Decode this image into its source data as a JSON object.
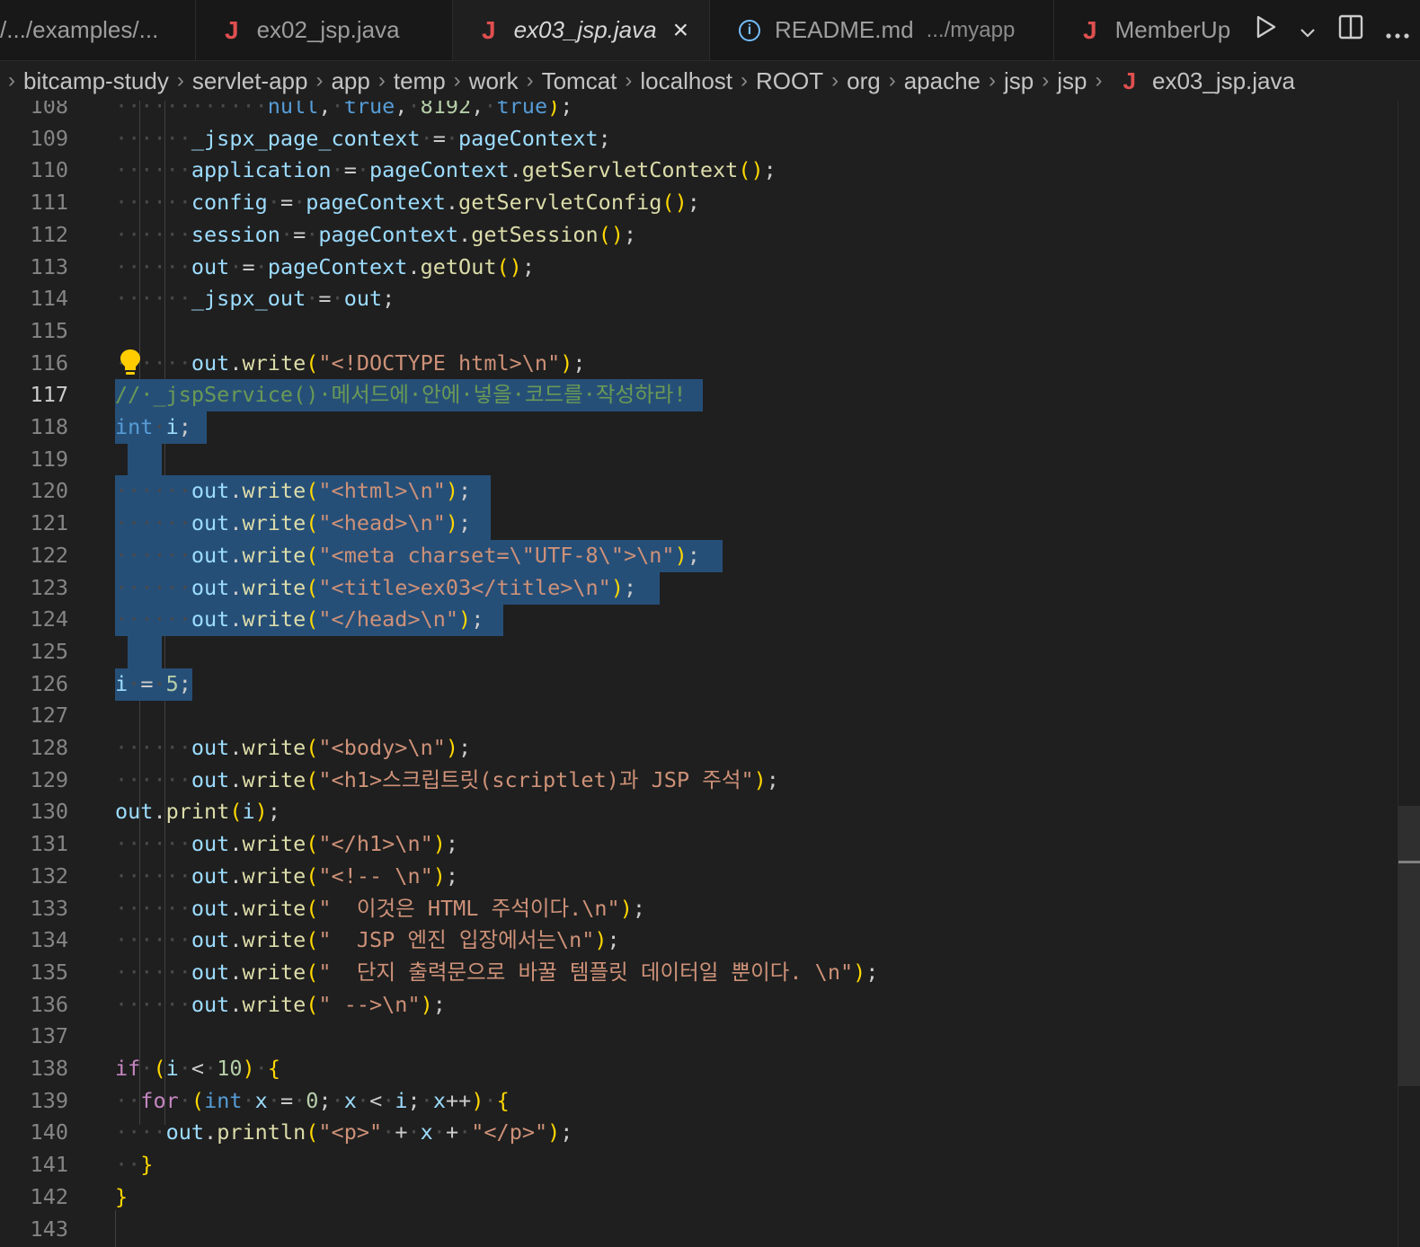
{
  "tabs": [
    {
      "label": "/.../examples/...",
      "desc": "",
      "icon": "none",
      "active": false
    },
    {
      "label": "ex02_jsp.java",
      "desc": "",
      "icon": "java-icon",
      "active": false
    },
    {
      "label": "ex03_jsp.java",
      "desc": "",
      "icon": "java-icon",
      "active": true
    },
    {
      "label": "README.md",
      "desc": ".../myapp",
      "icon": "info-icon",
      "active": false
    },
    {
      "label": "MemberUp",
      "desc": "",
      "icon": "java-icon",
      "active": false
    }
  ],
  "tab_actions": {
    "run_icon": "play-icon",
    "run_menu_icon": "chevron-down-icon",
    "split_icon": "split-editor-icon",
    "more_icon": "more-actions-icon"
  },
  "breadcrumb": [
    "bitcamp-study",
    "servlet-app",
    "app",
    "temp",
    "work",
    "Tomcat",
    "localhost",
    "ROOT",
    "org",
    "apache",
    "jsp",
    "jsp"
  ],
  "breadcrumb_file": "ex03_jsp.java",
  "current_line": 117,
  "colors": {
    "background": "#1f1f1f",
    "selection": "#264f78",
    "java_icon": "#e04f4f",
    "keyword": "#569cd6",
    "string": "#ce9178"
  },
  "lines": [
    {
      "n": "108",
      "text": "null, true, 8192, true);"
    },
    {
      "n": "109",
      "text": "_jspx_page_context = pageContext;"
    },
    {
      "n": "110",
      "text": "application = pageContext.getServletContext();"
    },
    {
      "n": "111",
      "text": "config = pageContext.getServletConfig();"
    },
    {
      "n": "112",
      "text": "session = pageContext.getSession();"
    },
    {
      "n": "113",
      "text": "out = pageContext.getOut();"
    },
    {
      "n": "114",
      "text": "_jspx_out = out;"
    },
    {
      "n": "115",
      "text": ""
    },
    {
      "n": "116",
      "text": "out.write(\"<!DOCTYPE html>\\n\");"
    },
    {
      "n": "117",
      "text": "// _jspService() 메서드에 안에 넣을 코드를 작성하라!"
    },
    {
      "n": "118",
      "text": "int i;"
    },
    {
      "n": "119",
      "text": ""
    },
    {
      "n": "120",
      "text": "out.write(\"<html>\\n\");"
    },
    {
      "n": "121",
      "text": "out.write(\"<head>\\n\");"
    },
    {
      "n": "122",
      "text": "out.write(\"<meta charset=\\\"UTF-8\\\">\\n\");"
    },
    {
      "n": "123",
      "text": "out.write(\"<title>ex03</title>\\n\");"
    },
    {
      "n": "124",
      "text": "out.write(\"</head>\\n\");"
    },
    {
      "n": "125",
      "text": ""
    },
    {
      "n": "126",
      "text": "i = 5;"
    },
    {
      "n": "127",
      "text": ""
    },
    {
      "n": "128",
      "text": "out.write(\"<body>\\n\");"
    },
    {
      "n": "129",
      "text": "out.write(\"<h1>스크립트릿(scriptlet)과 JSP 주석\");"
    },
    {
      "n": "130",
      "text": "out.print(i);"
    },
    {
      "n": "131",
      "text": "out.write(\"</h1>\\n\");"
    },
    {
      "n": "132",
      "text": "out.write(\"<!-- \\n\");"
    },
    {
      "n": "133",
      "text": "out.write(\"  이것은 HTML 주석이다.\\n\");"
    },
    {
      "n": "134",
      "text": "out.write(\"  JSP 엔진 입장에서는\\n\");"
    },
    {
      "n": "135",
      "text": "out.write(\"  단지 출력문으로 바꿀 템플릿 데이터일 뿐이다. \\n\");"
    },
    {
      "n": "136",
      "text": "out.write(\" -->\\n\");"
    },
    {
      "n": "137",
      "text": ""
    },
    {
      "n": "138",
      "text": "if (i < 10) {"
    },
    {
      "n": "139",
      "text": "for (int x = 0; x < i; x++) {"
    },
    {
      "n": "140",
      "text": "out.println(\"<p>\" + x + \"</p>\");"
    },
    {
      "n": "141",
      "text": "}"
    },
    {
      "n": "142",
      "text": "}"
    },
    {
      "n": "143",
      "text": ""
    }
  ]
}
